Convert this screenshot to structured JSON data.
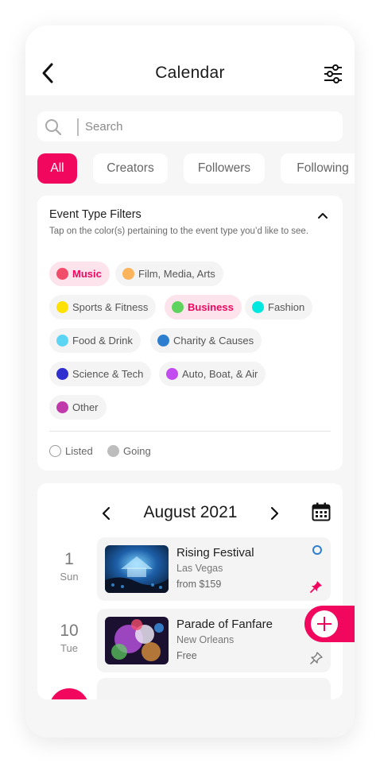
{
  "header": {
    "title": "Calendar",
    "back_icon": "chevron-left-icon",
    "settings_icon": "sliders-icon"
  },
  "search": {
    "placeholder": "Search",
    "value": ""
  },
  "tabs": [
    {
      "label": "All",
      "active": true
    },
    {
      "label": "Creators",
      "active": false
    },
    {
      "label": "Followers",
      "active": false
    },
    {
      "label": "Following",
      "active": false
    }
  ],
  "filters": {
    "title": "Event Type Filters",
    "description": "Tap on the color(s) pertaining to the event type you’d like to see.",
    "tags": [
      {
        "label": "Music",
        "color": "#f14d6b",
        "selected": true
      },
      {
        "label": "Film, Media, Arts",
        "color": "#fbb45c",
        "selected": false
      },
      {
        "label": "Sports & Fitness",
        "color": "#ffe100",
        "selected": false
      },
      {
        "label": "Business",
        "color": "#5ed45e",
        "selected": true
      },
      {
        "label": "Fashion",
        "color": "#00e8e0",
        "selected": false
      },
      {
        "label": "Food & Drink",
        "color": "#5bd5f3",
        "selected": false
      },
      {
        "label": "Charity & Causes",
        "color": "#2e7ecf",
        "selected": false
      },
      {
        "label": "Science & Tech",
        "color": "#2f2fcf",
        "selected": false
      },
      {
        "label": "Auto, Boat, & Air",
        "color": "#c24cf0",
        "selected": false
      },
      {
        "label": "Other",
        "color": "#c03aab",
        "selected": false
      }
    ],
    "legend": [
      {
        "label": "Listed",
        "style": "ring"
      },
      {
        "label": "Going",
        "style": "filled"
      }
    ]
  },
  "calendar": {
    "month": "August 2021",
    "events": [
      {
        "day": "1",
        "weekday": "Sun",
        "name": "Rising Festival",
        "location": "Las Vegas",
        "price": "from $159",
        "status": "listed",
        "pinned": true
      },
      {
        "day": "10",
        "weekday": "Tue",
        "name": "Parade of Fanfare",
        "location": "New Orleans",
        "price": "Free",
        "status": "none",
        "pinned": false
      }
    ]
  },
  "colors": {
    "accent": "#f2075f",
    "background": "#f6f6f7",
    "card": "#ffffff",
    "listed_ring": "#2e7ecf",
    "going_gray": "#bdbdbd"
  },
  "fab": {
    "icon": "plus-icon"
  }
}
